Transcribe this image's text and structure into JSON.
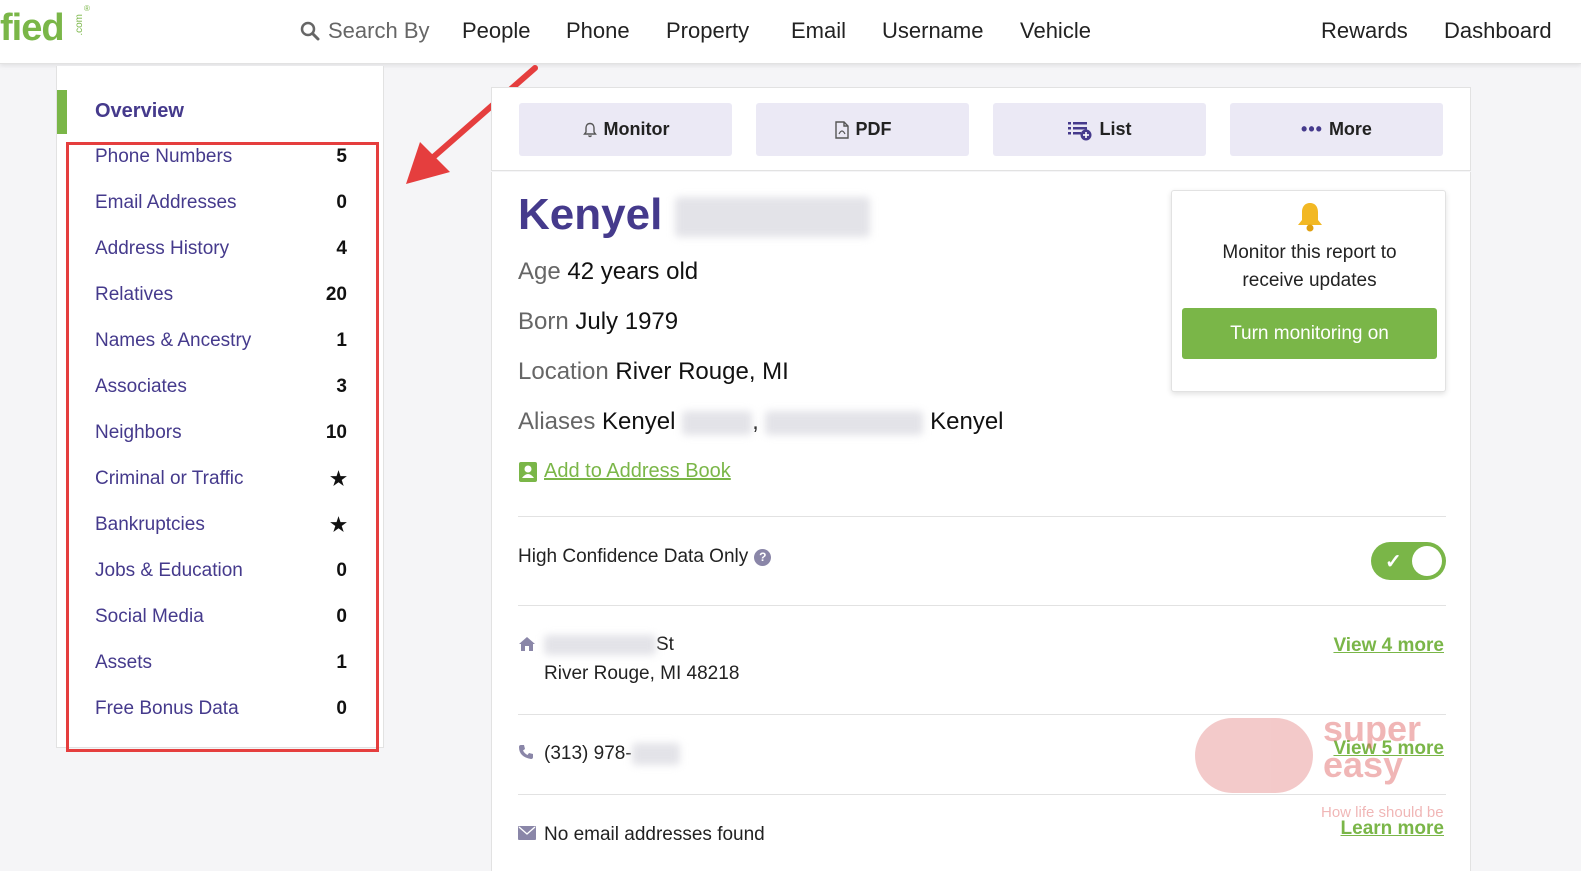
{
  "logo": {
    "text": "fied",
    "suffix": ".com",
    "reg": "®"
  },
  "nav": {
    "search_label": "Search By",
    "links": [
      "People",
      "Phone",
      "Property",
      "Email",
      "Username",
      "Vehicle"
    ],
    "right_links": [
      "Rewards",
      "Dashboard"
    ]
  },
  "sidebar": {
    "overview": "Overview",
    "items": [
      {
        "label": "Phone Numbers",
        "count": "5"
      },
      {
        "label": "Email Addresses",
        "count": "0"
      },
      {
        "label": "Address History",
        "count": "4"
      },
      {
        "label": "Relatives",
        "count": "20"
      },
      {
        "label": "Names & Ancestry",
        "count": "1"
      },
      {
        "label": "Associates",
        "count": "3"
      },
      {
        "label": "Neighbors",
        "count": "10"
      },
      {
        "label": "Criminal or Traffic",
        "count": "★"
      },
      {
        "label": "Bankruptcies",
        "count": "★"
      },
      {
        "label": "Jobs & Education",
        "count": "0"
      },
      {
        "label": "Social Media",
        "count": "0"
      },
      {
        "label": "Assets",
        "count": "1"
      },
      {
        "label": "Free Bonus Data",
        "count": "0"
      }
    ]
  },
  "toolbar": {
    "monitor": "Monitor",
    "pdf": "PDF",
    "list": "List",
    "more": "More"
  },
  "report": {
    "first_name": "Kenyel",
    "age_label": "Age",
    "age_value": "42 years old",
    "born_label": "Born",
    "born_value": "July 1979",
    "location_label": "Location",
    "location_value": "River Rouge, MI",
    "aliases_label": "Aliases",
    "alias_1": "Kenyel",
    "alias_sep": ",",
    "alias_2_tail": "Kenyel",
    "add_to_book": "Add to Address Book",
    "high_confidence": "High Confidence Data Only",
    "address_line1_tail": "St",
    "address_line2": "River Rouge, MI 48218",
    "address_more": "View 4 more",
    "phone_prefix": "(313) 978-",
    "phone_more": "View 5 more",
    "email_text": "No email addresses found",
    "email_more": "Learn more"
  },
  "monitor_box": {
    "text_line1": "Monitor this report to",
    "text_line2": "receive updates",
    "button": "Turn monitoring on"
  },
  "watermark": {
    "line1": "super",
    "line2": "easy",
    "tagline": "How life should be"
  },
  "colors": {
    "brand_green": "#7ab648",
    "brand_purple": "#453a8c",
    "highlight_red": "#e53e3e"
  }
}
